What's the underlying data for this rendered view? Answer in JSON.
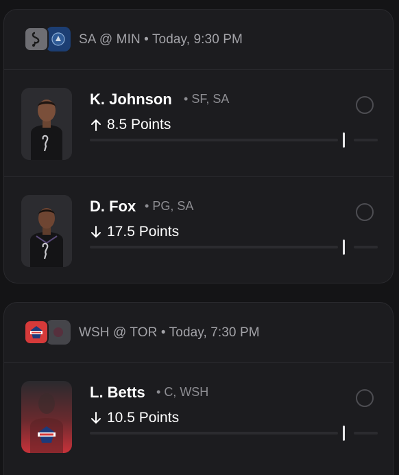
{
  "colors": {
    "background": "#141416",
    "card": "#1c1c1f",
    "spurs_logo_bg": "#6e6e73",
    "wolves_logo_bg": "#1c3e73",
    "wizards_logo_bg": "#d63a3a",
    "raptors_logo_bg": "#45454a"
  },
  "games": [
    {
      "matchup": "SA @ MIN",
      "time": "Today, 9:30 PM",
      "home_logo": "spurs-logo",
      "away_logo": "timberwolves-logo",
      "players": [
        {
          "name": "K. Johnson",
          "pos": "SF, SA",
          "direction": "up",
          "line": "8.5 Points",
          "avatar": "player-photo-spurs"
        },
        {
          "name": "D. Fox",
          "pos": "PG, SA",
          "direction": "down",
          "line": "17.5 Points",
          "avatar": "player-photo-spurs"
        }
      ]
    },
    {
      "matchup": "WSH @ TOR",
      "time": "Today, 7:30 PM",
      "home_logo": "wizards-logo",
      "away_logo": "raptors-logo",
      "players": [
        {
          "name": "L. Betts",
          "pos": "C, WSH",
          "direction": "down",
          "line": "10.5 Points",
          "avatar": "player-silhouette-wizards"
        }
      ]
    }
  ]
}
